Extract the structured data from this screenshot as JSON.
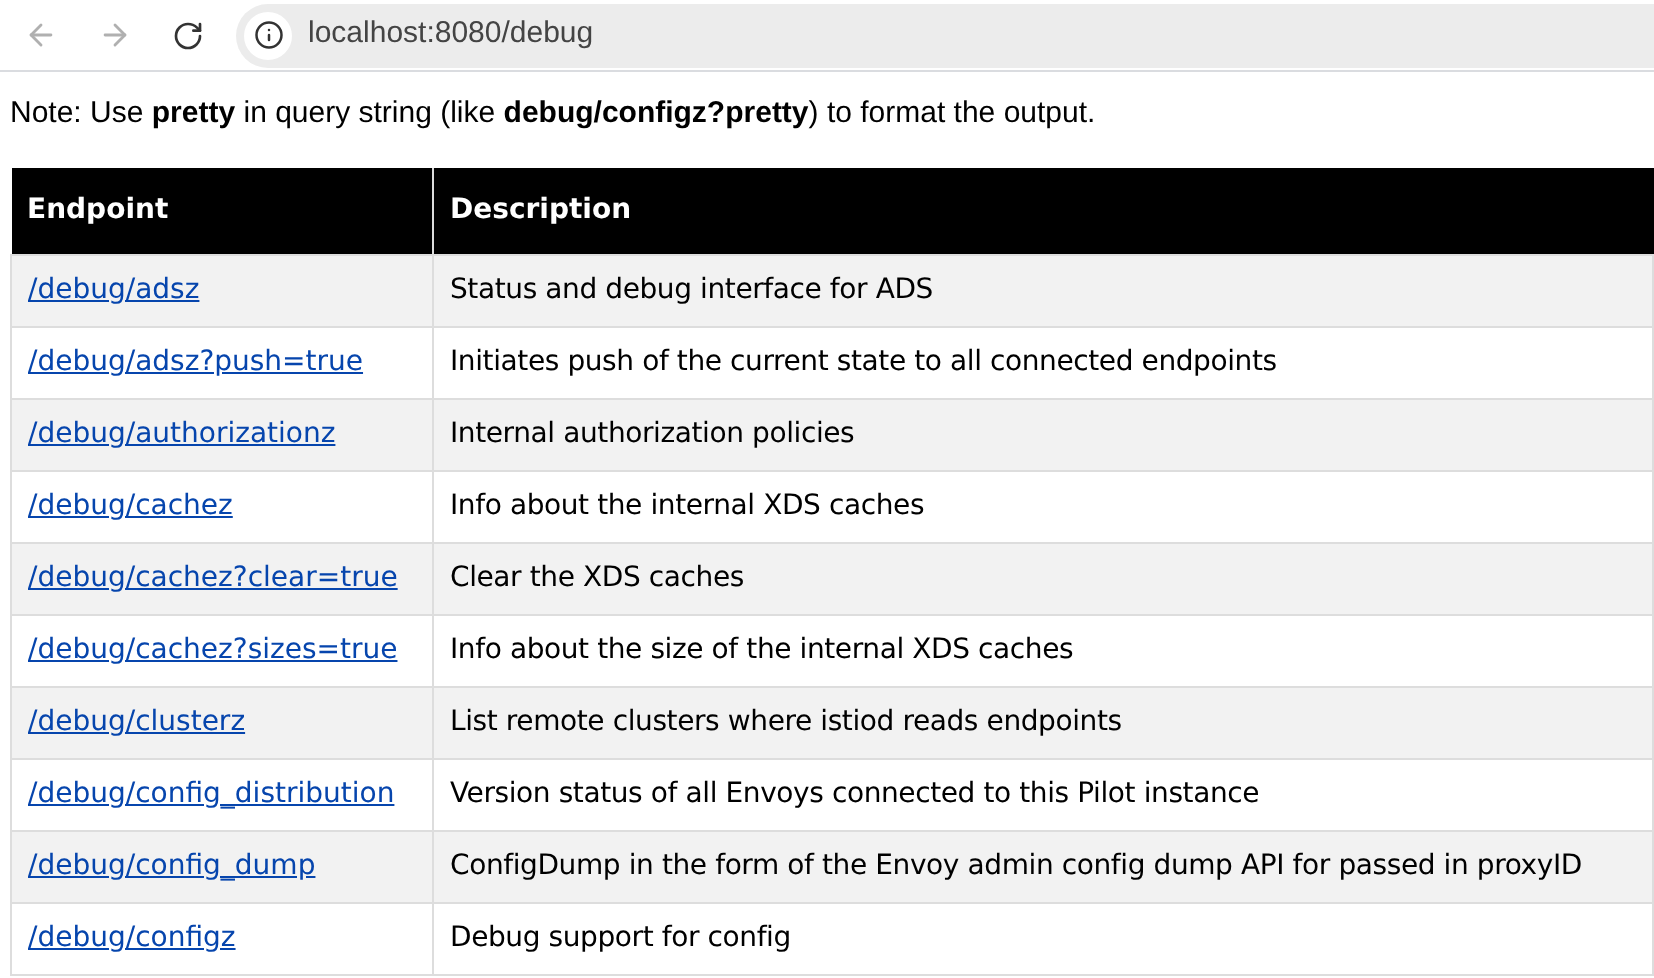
{
  "browser": {
    "url": "localhost:8080/debug"
  },
  "note": "Note: Use **pretty** in query string (like **debug/configz?pretty**) to format the output.",
  "table": {
    "columns": [
      "Endpoint",
      "Description"
    ],
    "rows": [
      {
        "endpoint": "/debug/adsz",
        "description": "Status and debug interface for ADS"
      },
      {
        "endpoint": "/debug/adsz?push=true",
        "description": "Initiates push of the current state to all connected endpoints"
      },
      {
        "endpoint": "/debug/authorizationz",
        "description": "Internal authorization policies"
      },
      {
        "endpoint": "/debug/cachez",
        "description": "Info about the internal XDS caches"
      },
      {
        "endpoint": "/debug/cachez?clear=true",
        "description": "Clear the XDS caches"
      },
      {
        "endpoint": "/debug/cachez?sizes=true",
        "description": "Info about the size of the internal XDS caches"
      },
      {
        "endpoint": "/debug/clusterz",
        "description": "List remote clusters where istiod reads endpoints"
      },
      {
        "endpoint": "/debug/config_distribution",
        "description": "Version status of all Envoys connected to this Pilot instance"
      },
      {
        "endpoint": "/debug/config_dump",
        "description": "ConfigDump in the form of the Envoy admin config dump API for passed in proxyID"
      },
      {
        "endpoint": "/debug/configz",
        "description": "Debug support for config"
      }
    ]
  }
}
